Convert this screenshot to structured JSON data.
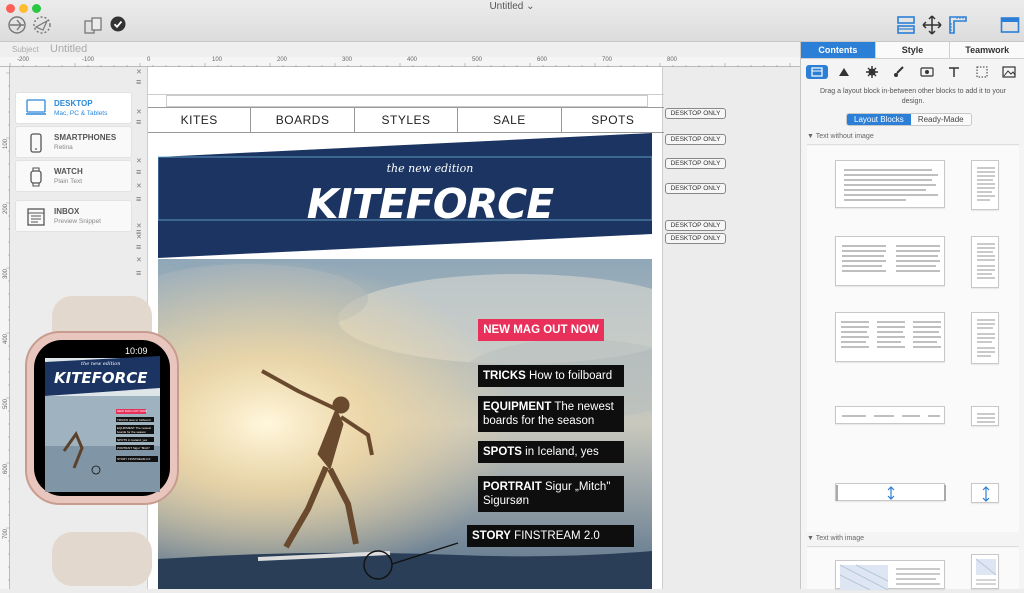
{
  "window": {
    "title": "Untitled ⌄"
  },
  "toolbar": {
    "left_icons": [
      "send-preview-icon",
      "send-test-icon",
      "upload-icon",
      "checkmark-icon"
    ],
    "right_icons": [
      "layout-icon",
      "move-icon",
      "ruler-guide-icon",
      "sidebar-icon"
    ]
  },
  "subject": {
    "label": "Subject",
    "value": "Untitled"
  },
  "ruler": {
    "h_labels": [
      "-200",
      "-100",
      "0",
      "100",
      "200",
      "300",
      "400",
      "500",
      "600",
      "700",
      "800"
    ],
    "v_labels": [
      "100",
      "200",
      "300",
      "400",
      "500",
      "600",
      "700"
    ]
  },
  "devices": [
    {
      "name": "DESKTOP",
      "sub": "Mac, PC & Tablets",
      "icon": "desktop-icon"
    },
    {
      "name": "SMARTPHONES",
      "sub": "Retina",
      "icon": "smartphone-icon"
    },
    {
      "name": "WATCH",
      "sub": "Plain Text",
      "icon": "watch-icon"
    },
    {
      "name": "INBOX",
      "sub": "Preview Snippet",
      "icon": "inbox-icon"
    }
  ],
  "nav": [
    "KITES",
    "BOARDS",
    "STYLES",
    "SALE",
    "SPOTS"
  ],
  "hero": {
    "subtitle": "the new edition",
    "title": "KITEFORCE",
    "color": "#1b3461"
  },
  "badge": {
    "text": "NEW MAG OUT NOW",
    "color": "#e8305a"
  },
  "teasers": [
    {
      "bold": "TRICKS",
      "rest": " How to foilboard"
    },
    {
      "bold": "EQUIPMENT",
      "rest": " The newest boards for the season"
    },
    {
      "bold": "SPOTS",
      "rest": " in Iceland, yes"
    },
    {
      "bold": "PORTRAIT",
      "rest": " Sigur „Mitch\" Sigursøn"
    },
    {
      "bold": "STORY",
      "rest": " FINSTREAM  2.0"
    }
  ],
  "desktop_only_label": "DESKTOP ONLY",
  "desktop_only_count": 6,
  "watch": {
    "time": "10:09",
    "subtitle": "the new edition",
    "title": "KITEFORCE",
    "badge": "NEW MAG OUT NOW",
    "items": [
      "TRICKS How to foilboard",
      "EQUIPMENT The newest boards for the season",
      "SPOTS in Iceland, yes",
      "PORTRAIT Sigur \"Mitch\"",
      "STORY FINSTREAM 2.0"
    ]
  },
  "panel": {
    "tabs": [
      "Contents",
      "Style",
      "Teamwork"
    ],
    "icons": [
      "layout-block-icon",
      "shape-icon",
      "gear-icon",
      "brush-icon",
      "image-icon",
      "text-icon",
      "frame-icon",
      "photo-icon"
    ],
    "hint": "Drag a layout block in-between other blocks to add it to your design.",
    "segments": [
      "Layout Blocks",
      "Ready-Made"
    ],
    "section1": "▼  Text without image",
    "section2": "▼  Text with image"
  },
  "accent": "#2b7fd6"
}
